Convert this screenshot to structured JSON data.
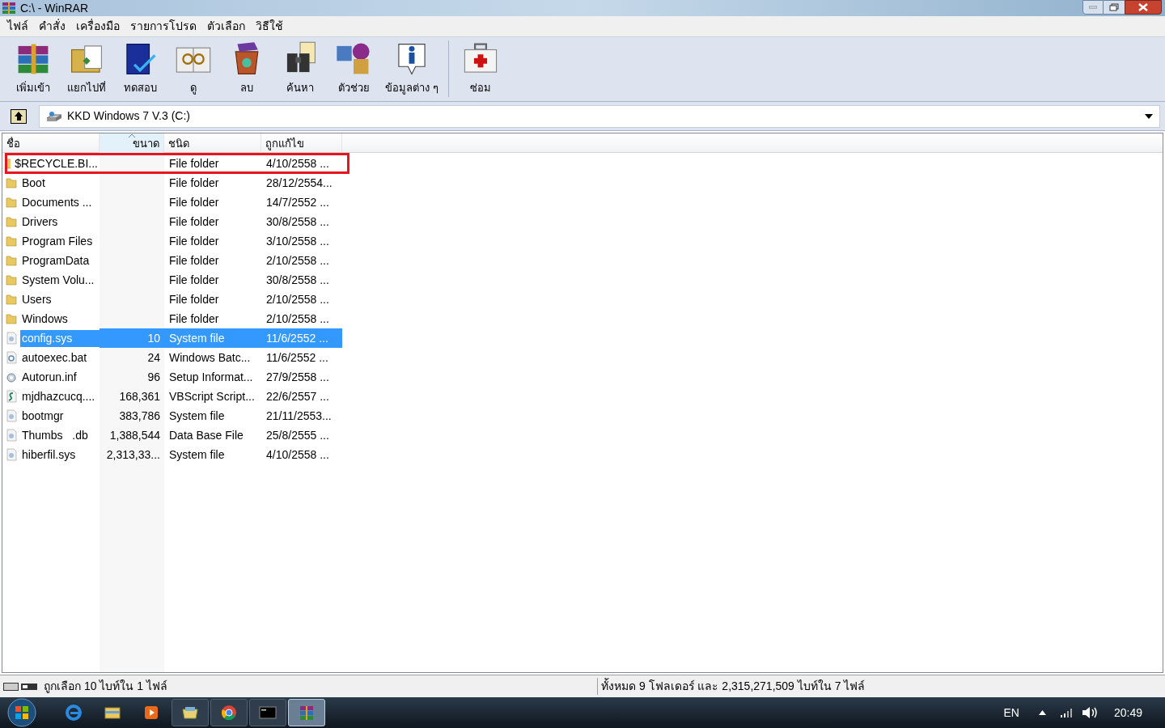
{
  "window": {
    "title": "C:\\ - WinRAR"
  },
  "menu": [
    "ไฟล์",
    "คำสั่ง",
    "เครื่องมือ",
    "รายการโปรด",
    "ตัวเลือก",
    "วิธีใช้"
  ],
  "toolbar": [
    {
      "kind": "add",
      "label": "เพิ่มเข้า"
    },
    {
      "kind": "extract",
      "label": "แยกไปที่"
    },
    {
      "kind": "test",
      "label": "ทดสอบ"
    },
    {
      "kind": "view",
      "label": "ดู"
    },
    {
      "kind": "delete",
      "label": "ลบ"
    },
    {
      "kind": "find",
      "label": "ค้นหา"
    },
    {
      "kind": "wizard",
      "label": "ตัวช่วย"
    },
    {
      "kind": "info",
      "label": "ข้อมูลต่าง ๆ"
    },
    {
      "kind": "repair",
      "label": "ซ่อม"
    }
  ],
  "address": {
    "value": "KKD Windows 7 V.3 (C:)"
  },
  "table": {
    "columns": [
      {
        "label": "ชื่อ",
        "sorted": false
      },
      {
        "label": "ขนาด",
        "sorted": true
      },
      {
        "label": "ชนิด",
        "sorted": false
      },
      {
        "label": "ถูกแก้ไข",
        "sorted": false
      }
    ],
    "rows": [
      {
        "kind": "folder",
        "name": "$RECYCLE.BI...",
        "size": "",
        "type": "File folder",
        "modified": "4/10/2558 ...",
        "selected": false,
        "highlighted": true
      },
      {
        "kind": "folder",
        "name": "Boot",
        "size": "",
        "type": "File folder",
        "modified": "28/12/2554...",
        "selected": false,
        "highlighted": false
      },
      {
        "kind": "folder",
        "name": "Documents ...",
        "size": "",
        "type": "File folder",
        "modified": "14/7/2552 ...",
        "selected": false,
        "highlighted": false
      },
      {
        "kind": "folder",
        "name": "Drivers",
        "size": "",
        "type": "File folder",
        "modified": "30/8/2558 ...",
        "selected": false,
        "highlighted": false
      },
      {
        "kind": "folder",
        "name": "Program Files",
        "size": "",
        "type": "File folder",
        "modified": "3/10/2558 ...",
        "selected": false,
        "highlighted": false
      },
      {
        "kind": "folder",
        "name": "ProgramData",
        "size": "",
        "type": "File folder",
        "modified": "2/10/2558 ...",
        "selected": false,
        "highlighted": false
      },
      {
        "kind": "folder",
        "name": "System Volu...",
        "size": "",
        "type": "File folder",
        "modified": "30/8/2558 ...",
        "selected": false,
        "highlighted": false
      },
      {
        "kind": "folder",
        "name": "Users",
        "size": "",
        "type": "File folder",
        "modified": "2/10/2558 ...",
        "selected": false,
        "highlighted": false
      },
      {
        "kind": "folder",
        "name": "Windows",
        "size": "",
        "type": "File folder",
        "modified": "2/10/2558 ...",
        "selected": false,
        "highlighted": false
      },
      {
        "kind": "file",
        "name": "config.sys",
        "size": "10",
        "type": "System file",
        "modified": "11/6/2552 ...",
        "selected": true,
        "highlighted": false
      },
      {
        "kind": "batch",
        "name": "autoexec.bat",
        "size": "24",
        "type": "Windows Batc...",
        "modified": "11/6/2552 ...",
        "selected": false,
        "highlighted": false
      },
      {
        "kind": "settings",
        "name": "Autorun.inf",
        "size": "96",
        "type": "Setup Informat...",
        "modified": "27/9/2558 ...",
        "selected": false,
        "highlighted": false
      },
      {
        "kind": "script",
        "name": "mjdhazcucq....",
        "size": "168,361",
        "type": "VBScript Script...",
        "modified": "22/6/2557 ...",
        "selected": false,
        "highlighted": false
      },
      {
        "kind": "file",
        "name": "bootmgr",
        "size": "383,786",
        "type": "System file",
        "modified": "21/11/2553...",
        "selected": false,
        "highlighted": false
      },
      {
        "kind": "file",
        "name": "Thumbs   .db",
        "size": "1,388,544",
        "type": "Data Base File",
        "modified": "25/8/2555 ...",
        "selected": false,
        "highlighted": false
      },
      {
        "kind": "file",
        "name": "hiberfil.sys",
        "size": "2,313,33...",
        "type": "System file",
        "modified": "4/10/2558 ...",
        "selected": false,
        "highlighted": false
      }
    ]
  },
  "status_bar": {
    "left": "ถูกเลือก 10 ไบท์ใน 1 ไฟล์",
    "right": "ทั้งหมด 9 โฟลเดอร์ และ 2,315,271,509 ไบท์ใน 7 ไฟล์"
  },
  "taskbar": {
    "apps": [
      {
        "kind": "ie",
        "active": false
      },
      {
        "kind": "explorer",
        "active": false
      },
      {
        "kind": "media",
        "active": false
      },
      {
        "kind": "folder",
        "active": false
      },
      {
        "kind": "chrome",
        "active": false
      },
      {
        "kind": "cmd",
        "active": false
      },
      {
        "kind": "winrar",
        "active": true
      }
    ],
    "language": "EN",
    "time": "20:49"
  }
}
